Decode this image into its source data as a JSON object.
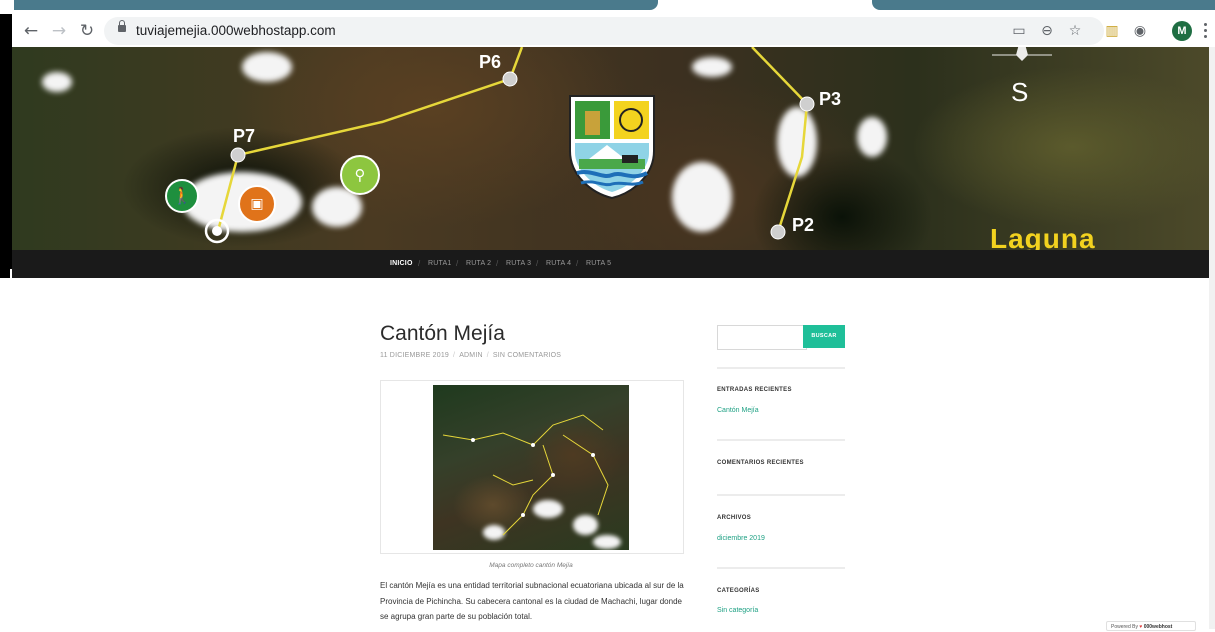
{
  "browser": {
    "url": "tuviajemejia.000webhostapp.com",
    "profile_initial": "M",
    "icons": [
      "back-icon",
      "forward-icon",
      "reload-icon",
      "lock-icon",
      "cast-icon",
      "zoom-icon",
      "star-icon",
      "extension-icon",
      "extension-icon",
      "profile-avatar",
      "menu-icon"
    ]
  },
  "hero": {
    "map_points": [
      {
        "label": "P6"
      },
      {
        "label": "P7"
      },
      {
        "label": "P3"
      },
      {
        "label": "P2"
      }
    ],
    "compass_label": "S",
    "lake_label": "Laguna"
  },
  "nav": {
    "items": [
      {
        "label": "INICIO",
        "active": true
      },
      {
        "label": "RUTA1",
        "active": false
      },
      {
        "label": "RUTA 2",
        "active": false
      },
      {
        "label": "RUTA 3",
        "active": false
      },
      {
        "label": "RUTA 4",
        "active": false
      },
      {
        "label": "RUTA 5",
        "active": false
      }
    ]
  },
  "post": {
    "title": "Cantón Mejía",
    "date": "11 DICIEMBRE 2019",
    "author": "ADMIN",
    "comments": "SIN COMENTARIOS",
    "caption": "Mapa completo cantón Mejía",
    "body": "El cantón Mejía es una entidad territorial subnacional ecuatoriana ubicada al sur de la Provincia de Pichincha. Su cabecera cantonal es la ciudad de Machachi, lugar donde se agrupa gran parte de su población total."
  },
  "sidebar": {
    "search_placeholder": "",
    "search_button": "BUSCAR",
    "recent_posts_title": "ENTRADAS RECIENTES",
    "recent_posts": [
      "Cantón Mejía"
    ],
    "recent_comments_title": "COMENTARIOS RECIENTES",
    "archives_title": "ARCHIVOS",
    "archives": [
      "diciembre 2019"
    ],
    "categories_title": "CATEGORÍAS",
    "categories": [
      "Sin categoría"
    ]
  },
  "footer": {
    "powered_prefix": "Powered By",
    "powered_brand": "000webhost"
  },
  "colors": {
    "accent": "#1fbf99",
    "nav_bg": "#1a1a1a",
    "tab_accent": "#4a7a8c"
  }
}
